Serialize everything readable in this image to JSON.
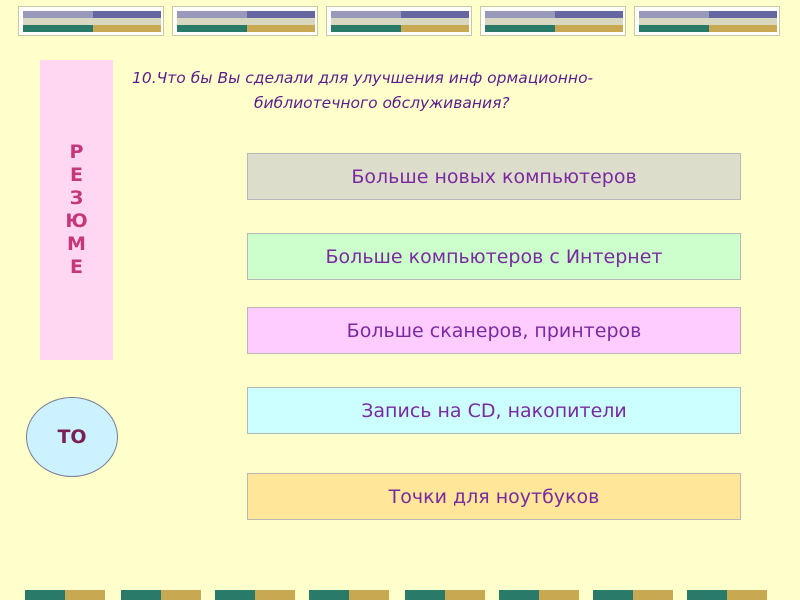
{
  "question": {
    "line1": "10.Что бы  Вы  сделали для улучшения инф ормационно-",
    "line2": "библиотечного обслуживания?"
  },
  "side_label": {
    "letters": [
      "Р",
      "Е",
      "З",
      "Ю",
      "М",
      "Е"
    ]
  },
  "circle_label": "ТО",
  "answers": [
    "Больше новых компьютеров",
    "Больше компьютеров с Интернет",
    "Больше сканеров, принтеров",
    "Запись на CD, накопители",
    "Точки для ноутбуков"
  ],
  "colors": {
    "background": "#FFFFCC",
    "side_panel": "#FFD7F2",
    "side_text": "#C4387A",
    "question_text": "#5A1E8C",
    "answer_text": "#7A2AA0",
    "answer_1": "#DDDDCC",
    "answer_2": "#CCFFCC",
    "answer_3": "#FFCCFF",
    "answer_4": "#CCFFFF",
    "answer_5": "#FFE699",
    "circle_fill": "#CCF2FF"
  }
}
